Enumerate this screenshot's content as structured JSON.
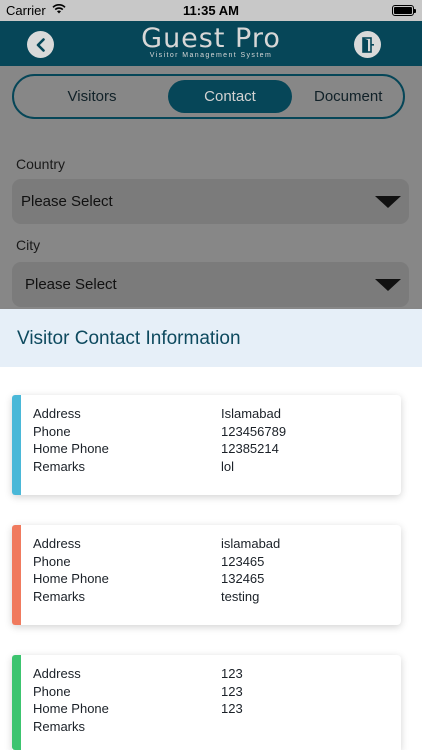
{
  "status_bar": {
    "carrier": "Carrier",
    "time": "11:35 AM"
  },
  "brand": {
    "name": "Guest Pro",
    "tagline": "Visitor Management System"
  },
  "tabs": [
    {
      "label": "Visitors",
      "active": false
    },
    {
      "label": "Contact",
      "active": true
    },
    {
      "label": "Document",
      "active": false
    }
  ],
  "form": {
    "country_label": "Country",
    "country_value": "Please Select",
    "city_label": "City",
    "city_value": "Please Select"
  },
  "panel": {
    "title": "Visitor Contact Information"
  },
  "field_labels": {
    "address": "Address",
    "phone": "Phone",
    "home_phone": "Home Phone",
    "remarks": "Remarks"
  },
  "contacts": [
    {
      "accent": "#4ab8d8",
      "address": "Islamabad",
      "phone": "123456789",
      "home_phone": "12385214",
      "remarks": "lol"
    },
    {
      "accent": "#f07a5e",
      "address": "islamabad",
      "phone": "123465",
      "home_phone": "132465",
      "remarks": "testing"
    },
    {
      "accent": "#3cc46f",
      "address": "123",
      "phone": "123",
      "home_phone": "123",
      "remarks": ""
    }
  ],
  "colors": {
    "header": "#064658",
    "overlay": "#878787",
    "panel_header": "#e6eff8"
  },
  "icons": {
    "back": "chevron-left-icon",
    "logout": "logout-door-icon",
    "wifi": "wifi-icon",
    "battery": "battery-icon",
    "dropdown": "caret-down-icon"
  }
}
